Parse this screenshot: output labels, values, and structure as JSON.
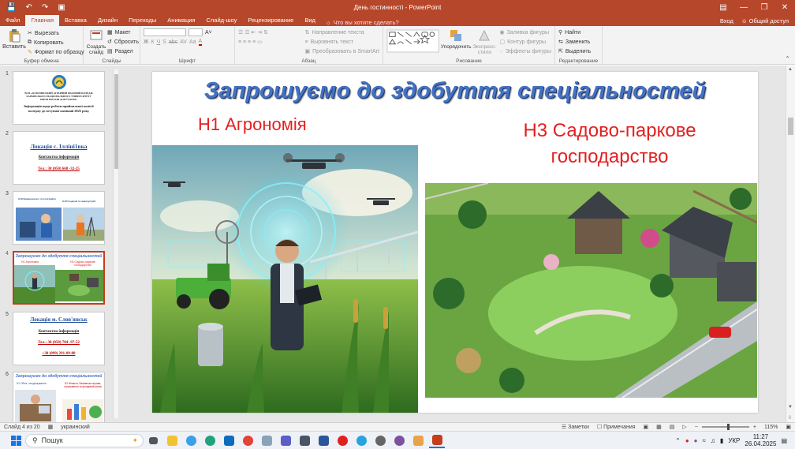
{
  "titlebar": {
    "document_title": "День гостинності - PowerPoint",
    "quick_access": [
      "save",
      "undo",
      "redo",
      "present"
    ],
    "window_controls": [
      "minimize",
      "restore",
      "close"
    ]
  },
  "ribbon_tabs": {
    "items": [
      "Файл",
      "Главная",
      "Вставка",
      "Дизайн",
      "Переходы",
      "Анимация",
      "Слайд-шоу",
      "Рецензирование",
      "Вид"
    ],
    "active": "Главная",
    "tell_me": "Что вы хотите сделать?",
    "sign_in": "Вход",
    "share": "Общий доступ"
  },
  "ribbon": {
    "clipboard": {
      "paste": "Вставить",
      "cut": "Вырезать",
      "copy": "Копировать",
      "format_painter": "Формат по образцу",
      "group_name": "Буфер обмена"
    },
    "slides": {
      "new_slide": "Создать слайд",
      "layout": "Макет",
      "reset": "Сбросить",
      "section": "Раздел",
      "group_name": "Слайды"
    },
    "font": {
      "group_name": "Шрифт",
      "font_name": "",
      "font_size": "",
      "styles": [
        "Ж",
        "К",
        "Ч",
        "S",
        "abc",
        "AV",
        "Aa",
        "A"
      ]
    },
    "paragraph": {
      "text_direction": "Направление текста",
      "align_text": "Выровнять текст",
      "smartart": "Преобразовать в SmartArt",
      "group_name": "Абзац"
    },
    "drawing": {
      "arrange": "Упорядочить",
      "quick_styles": "Экспресс-стили",
      "shape_fill": "Заливка фигуры",
      "shape_outline": "Контур фигуры",
      "shape_effects": "Эффекты фигуры",
      "group_name": "Рисование"
    },
    "editing": {
      "find": "Найти",
      "replace": "Заменить",
      "select": "Выделить",
      "group_name": "Редактирование"
    }
  },
  "thumbnails": [
    {
      "number": "1",
      "lines": [
        "ВСП «ЗОЛОЧІВСЬКИЙ АГРАРНИЙ ФАХОВИЙ КОЛЕДЖ",
        "ХАРКІВСЬКОГО НАЦІОНАЛЬНОГО УНІВЕРСИТЕТУ",
        "ІМЕНІ ВАСИЛЯ ДОКУЧАЄВА»",
        "Інформація щодо роботи приймальної комісії",
        "коледжу до вступної кампанії 2025 року"
      ]
    },
    {
      "number": "2",
      "lines": [
        "Локація с. Ілліні1вка",
        "Контактна інформація",
        "Тел.: 38 (050) 668 -32-25"
      ]
    },
    {
      "number": "3",
      "lines": [
        "G18 Видавництво та поліграфія",
        "G18 Геодезія та землеустрій"
      ]
    },
    {
      "number": "4",
      "lines": [
        "Запрошуємо до здобуття спеціальностей",
        "Н1 Агрономія",
        "Н3 Садово-паркове господарство"
      ]
    },
    {
      "number": "5",
      "lines": [
        "Локація м. Слов'янськ",
        "Контактна інформація",
        "Тел.: 38 (050) 704 -97-52",
        "+38 (099) 291-89-88"
      ]
    },
    {
      "number": "6",
      "lines": [
        "Запрошуємо до здобуття спеціальностей",
        "D1 Облік і оподаткування",
        "D2 Фінанси, банківська справа, страхування та фондовий ринок"
      ]
    }
  ],
  "selected_slide": 4,
  "slide": {
    "title": "Запрошуємо до здобуття спеціальностей",
    "specialty_1": "Н1 Агрономія",
    "specialty_2_line1": "Н3 Садово-паркове",
    "specialty_2_line2": "господарство",
    "image_1": "agronomist with tablet, drones and tractor in a field",
    "image_2": "aerial view of landscaped garden with houses"
  },
  "statusbar": {
    "slide_counter": "Слайд 4 из 20",
    "language": "украинский",
    "notes": "Заметки",
    "comments": "Примечания",
    "zoom": "115%"
  },
  "taskbar": {
    "search_placeholder": "Пошук",
    "language": "УКР",
    "time": "11:27",
    "date": "26.04.2025"
  },
  "colors": {
    "accent": "#b7472a",
    "title_blue": "#4472c4",
    "specialty_red": "#e32020",
    "selected_border": "#c43e1c"
  }
}
